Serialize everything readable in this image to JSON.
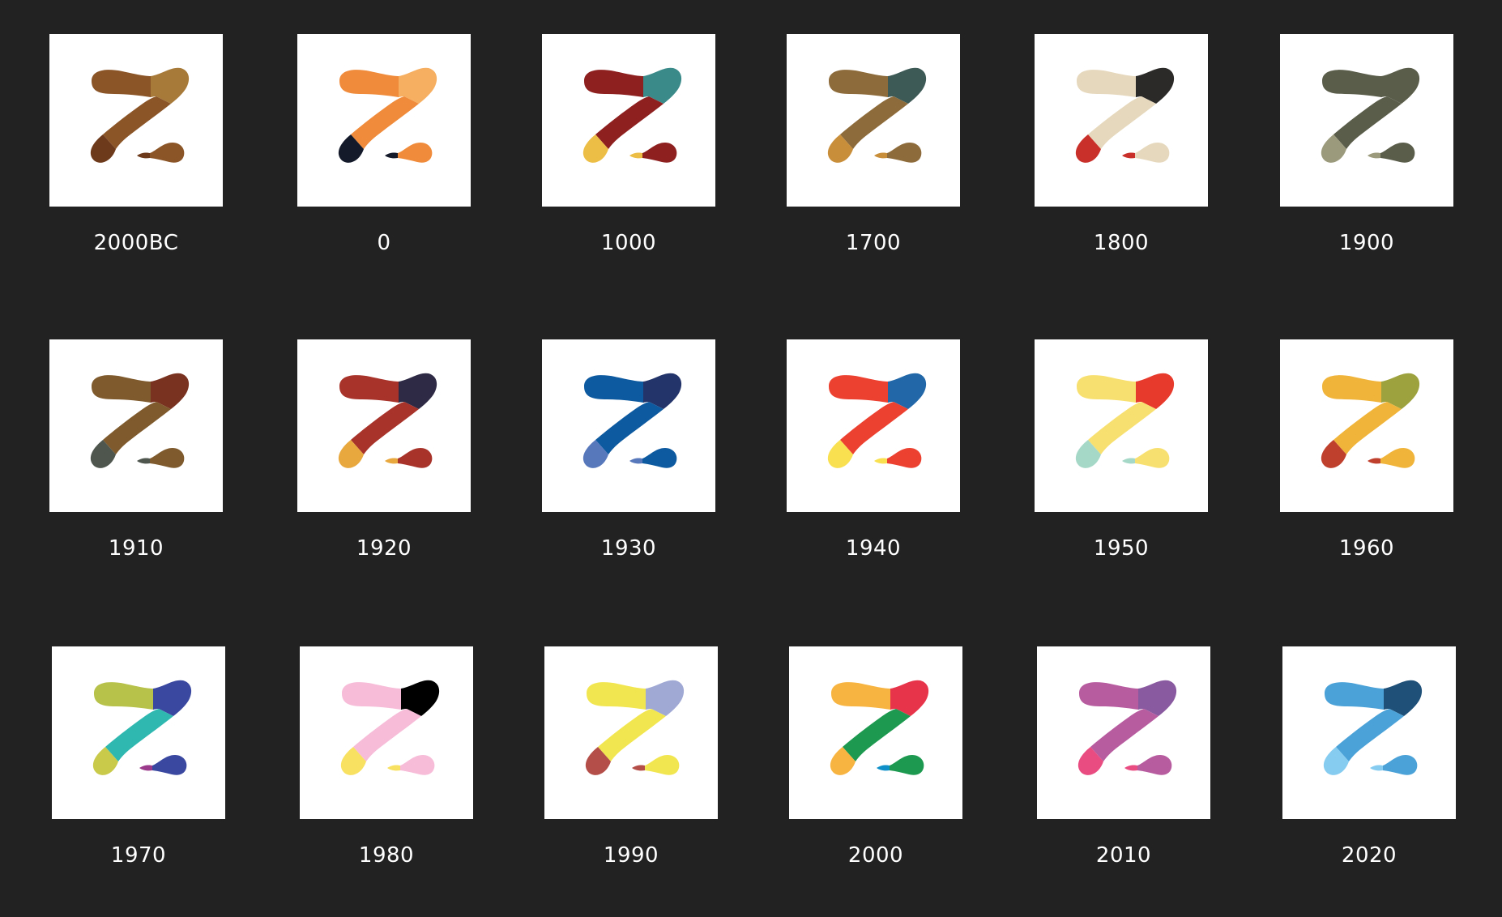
{
  "logos": [
    {
      "label": "2000BC",
      "colors": {
        "topLeft": "#8B5528",
        "topRight": "#A87A3A",
        "middle": "#8B5528",
        "bottomLeft": "#6E3A1C",
        "bottomRight": "#8B5528",
        "accent": "#6E3A1C"
      }
    },
    {
      "label": "0",
      "colors": {
        "topLeft": "#EF8B3A",
        "topRight": "#F6AE60",
        "middle": "#EF8B3A",
        "bottomLeft": "#151A2B",
        "bottomRight": "#EF8B3A",
        "accent": "#151A2B"
      }
    },
    {
      "label": "1000",
      "colors": {
        "topLeft": "#8E2020",
        "topRight": "#3B8A8A",
        "middle": "#8E2020",
        "bottomLeft": "#EDBE45",
        "bottomRight": "#8E2020",
        "accent": "#EDBE45"
      }
    },
    {
      "label": "1700",
      "colors": {
        "topLeft": "#8E6B3A",
        "topRight": "#3E5A56",
        "middle": "#8E6B3A",
        "bottomLeft": "#C98E3A",
        "bottomRight": "#8E6B3A",
        "accent": "#C98E3A"
      }
    },
    {
      "label": "1800",
      "colors": {
        "topLeft": "#E6D8BC",
        "topRight": "#2C2A28",
        "middle": "#E6D8BC",
        "bottomLeft": "#C9302A",
        "bottomRight": "#E6D8BC",
        "accent": "#C9302A"
      }
    },
    {
      "label": "1900",
      "colors": {
        "topLeft": "#5A5D4A",
        "topRight": "#5A5D4A",
        "middle": "#5A5D4A",
        "bottomLeft": "#9C9A7C",
        "bottomRight": "#5A5D4A",
        "accent": "#9C9A7C"
      }
    },
    {
      "label": "1910",
      "colors": {
        "topLeft": "#7E5A2C",
        "topRight": "#7A3220",
        "middle": "#7E5A2C",
        "bottomLeft": "#4E564E",
        "bottomRight": "#7E5A2C",
        "accent": "#4E564E"
      }
    },
    {
      "label": "1920",
      "colors": {
        "topLeft": "#A8332A",
        "topRight": "#2E2A45",
        "middle": "#A8332A",
        "bottomLeft": "#E8A83E",
        "bottomRight": "#A8332A",
        "accent": "#E8A83E"
      }
    },
    {
      "label": "1930",
      "colors": {
        "topLeft": "#0E5AA0",
        "topRight": "#23346A",
        "middle": "#0E5AA0",
        "bottomLeft": "#5878BC",
        "bottomRight": "#0E5AA0",
        "accent": "#5878BC"
      }
    },
    {
      "label": "1940",
      "colors": {
        "topLeft": "#EC4030",
        "topRight": "#2268A8",
        "middle": "#EC4030",
        "bottomLeft": "#F8E050",
        "bottomRight": "#EC4030",
        "accent": "#F8E050"
      }
    },
    {
      "label": "1950",
      "colors": {
        "topLeft": "#F8E070",
        "topRight": "#E83A2C",
        "middle": "#F8E070",
        "bottomLeft": "#A6D8C8",
        "bottomRight": "#F8E070",
        "accent": "#A6D8C8"
      }
    },
    {
      "label": "1960",
      "colors": {
        "topLeft": "#F0B43A",
        "topRight": "#9EA23E",
        "middle": "#F0B43A",
        "bottomLeft": "#C0402E",
        "bottomRight": "#F0B43A",
        "accent": "#C0402E"
      }
    },
    {
      "label": "1970",
      "colors": {
        "topLeft": "#B7C24A",
        "topRight": "#3A48A0",
        "middle": "#2EB8B0",
        "bottomLeft": "#C9C94A",
        "bottomRight": "#3A48A0",
        "accent": "#9B3A8A"
      }
    },
    {
      "label": "1980",
      "colors": {
        "topLeft": "#F6BCD8",
        "topRight": "#000000",
        "middle": "#F6BCD8",
        "bottomLeft": "#F8E060",
        "bottomRight": "#F6BCD8",
        "accent": "#F8E060"
      }
    },
    {
      "label": "1990",
      "colors": {
        "topLeft": "#F2E650",
        "topRight": "#A0A8D4",
        "middle": "#F2E650",
        "bottomLeft": "#B44E48",
        "bottomRight": "#F2E650",
        "accent": "#B44E48"
      }
    },
    {
      "label": "2000",
      "colors": {
        "topLeft": "#F8B440",
        "topRight": "#E8344A",
        "middle": "#1E9A50",
        "bottomLeft": "#F8B440",
        "bottomRight": "#1E9A50",
        "accent": "#0F90C8"
      }
    },
    {
      "label": "2010",
      "colors": {
        "topLeft": "#B85CA0",
        "topRight": "#8A5AA0",
        "middle": "#B85CA0",
        "bottomLeft": "#E84C80",
        "bottomRight": "#B85CA0",
        "accent": "#E84C80"
      }
    },
    {
      "label": "2020",
      "colors": {
        "topLeft": "#4BA2D8",
        "topRight": "#1E5078",
        "middle": "#4BA2D8",
        "bottomLeft": "#86CCF0",
        "bottomRight": "#4BA2D8",
        "accent": "#86CCF0"
      }
    }
  ]
}
